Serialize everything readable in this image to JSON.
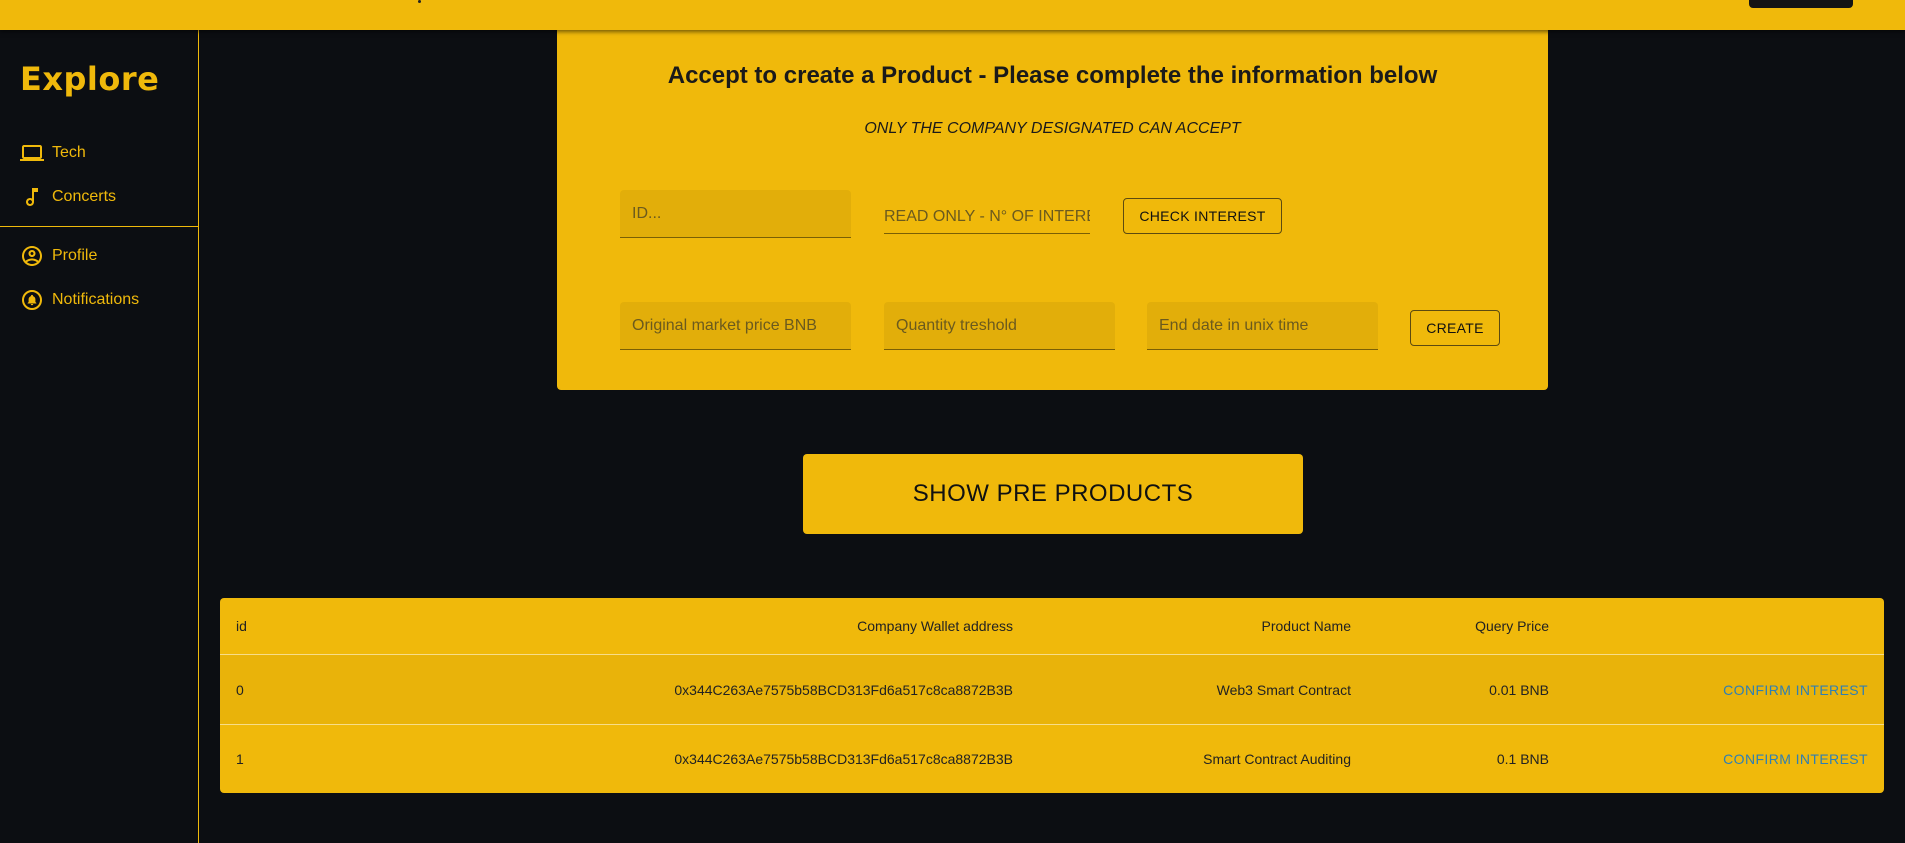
{
  "app": {
    "title": "Explore"
  },
  "sidebar": {
    "items": [
      {
        "label": "Tech",
        "icon": "laptop-icon"
      },
      {
        "label": "Concerts",
        "icon": "music-note-icon"
      }
    ],
    "account_items": [
      {
        "label": "Profile",
        "icon": "account-circle-icon"
      },
      {
        "label": "Notifications",
        "icon": "notification-bell-icon"
      }
    ]
  },
  "form": {
    "title": "Accept to create a Product - Please complete the information below",
    "subtitle": "ONLY THE COMPANY DESIGNATED CAN ACCEPT",
    "id_placeholder": "ID...",
    "interest_placeholder": "READ ONLY - N° OF INTERESTED",
    "check_label": "CHECK INTEREST",
    "price_placeholder": "Original market price BNB",
    "quantity_placeholder": "Quantity treshold",
    "end_date_placeholder": "End date in unix time",
    "create_label": "CREATE"
  },
  "show_button": {
    "label": "SHOW PRE PRODUCTS"
  },
  "table": {
    "headers": [
      "id",
      "Company Wallet address",
      "Product Name",
      "Query Price",
      ""
    ],
    "rows": [
      {
        "id": "0",
        "wallet": "0x344C263Ae7575b58BCD313Fd6a517c8ca8872B3B",
        "product": "Web3 Smart Contract",
        "price": "0.01 BNB",
        "action": "CONFIRM INTEREST"
      },
      {
        "id": "1",
        "wallet": "0x344C263Ae7575b58BCD313Fd6a517c8ca8872B3B",
        "product": "Smart Contract Auditing",
        "price": "0.1 BNB",
        "action": "CONFIRM INTEREST"
      }
    ]
  },
  "colors": {
    "accent": "#f0b90b",
    "background": "#0c0e12",
    "link": "#2f7fb3"
  }
}
